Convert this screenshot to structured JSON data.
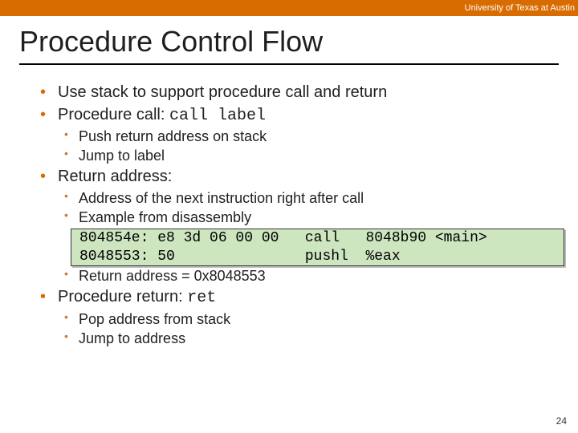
{
  "header": {
    "org": "University of Texas at Austin"
  },
  "title": "Procedure Control Flow",
  "bullets": {
    "b1": "Use stack to support procedure call and return",
    "b2_prefix": "Procedure call: ",
    "b2_code": "call label",
    "b2_sub1": "Push return address on stack",
    "b2_sub2": "Jump to label",
    "b3": "Return address:",
    "b3_sub1": "Address of the next instruction right after call",
    "b3_sub2": "Example from disassembly",
    "code_line1": "804854e: e8 3d 06 00 00   call   8048b90 <main>",
    "code_line2": "8048553: 50               pushl  %eax",
    "b3_sub3": "Return address = 0x8048553",
    "b4_prefix": "Procedure return: ",
    "b4_code": "ret",
    "b4_sub1": "Pop address from stack",
    "b4_sub2": "Jump to address"
  },
  "page_number": "24"
}
